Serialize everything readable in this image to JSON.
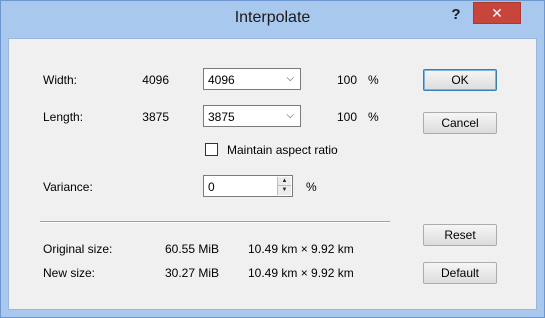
{
  "window": {
    "title": "Interpolate",
    "help_label": "?",
    "close_label": "✕"
  },
  "width": {
    "label": "Width:",
    "current": "4096",
    "selected": "4096",
    "percent": "100",
    "unit": "%"
  },
  "length": {
    "label": "Length:",
    "current": "3875",
    "selected": "3875",
    "percent": "100",
    "unit": "%"
  },
  "aspect": {
    "label": "Maintain aspect ratio",
    "checked": false
  },
  "variance": {
    "label": "Variance:",
    "value": "0",
    "unit": "%"
  },
  "original_size": {
    "label": "Original size:",
    "size": "60.55 MiB",
    "dimensions": "10.49 km × 9.92 km"
  },
  "new_size": {
    "label": "New size:",
    "size": "30.27 MiB",
    "dimensions": "10.49 km × 9.92 km"
  },
  "buttons": {
    "ok": "OK",
    "cancel": "Cancel",
    "reset": "Reset",
    "default": "Default"
  },
  "icons": {
    "dropdown": "chevron-down-icon",
    "spin_up": "spin-up-icon",
    "spin_down": "spin-down-icon"
  }
}
